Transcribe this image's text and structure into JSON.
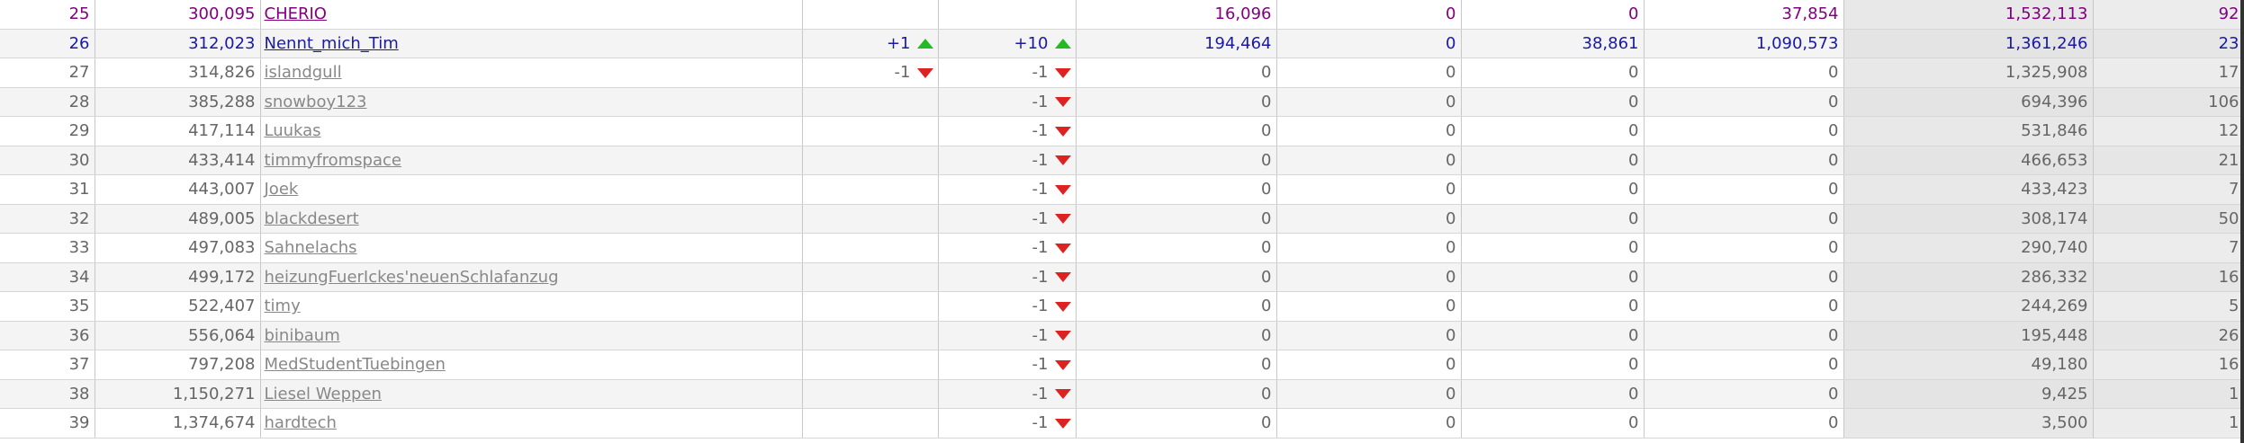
{
  "colors": {
    "highlight_text": "#800080",
    "self_text": "#1a1aa6",
    "muted_text": "#666666",
    "up_arrow": "#22bb22",
    "down_arrow": "#dd2222"
  },
  "rows": [
    {
      "pos": "25",
      "rank": "300,095",
      "name": "CHERIO",
      "change1": "",
      "dir1": "",
      "change2": "",
      "dir2": "",
      "v1": "16,096",
      "v2": "0",
      "v3": "0",
      "v4": "37,854",
      "total": "1,532,113",
      "last": "92",
      "style": "highlight"
    },
    {
      "pos": "26",
      "rank": "312,023",
      "name": "Nennt_mich_Tim",
      "change1": "+1",
      "dir1": "up",
      "change2": "+10",
      "dir2": "up",
      "v1": "194,464",
      "v2": "0",
      "v3": "38,861",
      "v4": "1,090,573",
      "total": "1,361,246",
      "last": "23",
      "style": "self"
    },
    {
      "pos": "27",
      "rank": "314,826",
      "name": "islandgull",
      "change1": "-1",
      "dir1": "down",
      "change2": "-1",
      "dir2": "down",
      "v1": "0",
      "v2": "0",
      "v3": "0",
      "v4": "0",
      "total": "1,325,908",
      "last": "17",
      "style": "normal"
    },
    {
      "pos": "28",
      "rank": "385,288",
      "name": "snowboy123",
      "change1": "",
      "dir1": "",
      "change2": "-1",
      "dir2": "down",
      "v1": "0",
      "v2": "0",
      "v3": "0",
      "v4": "0",
      "total": "694,396",
      "last": "106",
      "style": "normal"
    },
    {
      "pos": "29",
      "rank": "417,114",
      "name": "Luukas",
      "change1": "",
      "dir1": "",
      "change2": "-1",
      "dir2": "down",
      "v1": "0",
      "v2": "0",
      "v3": "0",
      "v4": "0",
      "total": "531,846",
      "last": "12",
      "style": "normal"
    },
    {
      "pos": "30",
      "rank": "433,414",
      "name": "timmyfromspace",
      "change1": "",
      "dir1": "",
      "change2": "-1",
      "dir2": "down",
      "v1": "0",
      "v2": "0",
      "v3": "0",
      "v4": "0",
      "total": "466,653",
      "last": "21",
      "style": "normal"
    },
    {
      "pos": "31",
      "rank": "443,007",
      "name": "Joek",
      "change1": "",
      "dir1": "",
      "change2": "-1",
      "dir2": "down",
      "v1": "0",
      "v2": "0",
      "v3": "0",
      "v4": "0",
      "total": "433,423",
      "last": "7",
      "style": "normal"
    },
    {
      "pos": "32",
      "rank": "489,005",
      "name": "blackdesert",
      "change1": "",
      "dir1": "",
      "change2": "-1",
      "dir2": "down",
      "v1": "0",
      "v2": "0",
      "v3": "0",
      "v4": "0",
      "total": "308,174",
      "last": "50",
      "style": "normal"
    },
    {
      "pos": "33",
      "rank": "497,083",
      "name": "Sahnelachs",
      "change1": "",
      "dir1": "",
      "change2": "-1",
      "dir2": "down",
      "v1": "0",
      "v2": "0",
      "v3": "0",
      "v4": "0",
      "total": "290,740",
      "last": "7",
      "style": "normal"
    },
    {
      "pos": "34",
      "rank": "499,172",
      "name": "heizungFuerIckes'neuenSchlafanzug",
      "change1": "",
      "dir1": "",
      "change2": "-1",
      "dir2": "down",
      "v1": "0",
      "v2": "0",
      "v3": "0",
      "v4": "0",
      "total": "286,332",
      "last": "16",
      "style": "normal"
    },
    {
      "pos": "35",
      "rank": "522,407",
      "name": "timy",
      "change1": "",
      "dir1": "",
      "change2": "-1",
      "dir2": "down",
      "v1": "0",
      "v2": "0",
      "v3": "0",
      "v4": "0",
      "total": "244,269",
      "last": "5",
      "style": "normal"
    },
    {
      "pos": "36",
      "rank": "556,064",
      "name": "binibaum",
      "change1": "",
      "dir1": "",
      "change2": "-1",
      "dir2": "down",
      "v1": "0",
      "v2": "0",
      "v3": "0",
      "v4": "0",
      "total": "195,448",
      "last": "26",
      "style": "normal"
    },
    {
      "pos": "37",
      "rank": "797,208",
      "name": "MedStudentTuebingen",
      "change1": "",
      "dir1": "",
      "change2": "-1",
      "dir2": "down",
      "v1": "0",
      "v2": "0",
      "v3": "0",
      "v4": "0",
      "total": "49,180",
      "last": "16",
      "style": "normal"
    },
    {
      "pos": "38",
      "rank": "1,150,271",
      "name": "Liesel Weppen",
      "change1": "",
      "dir1": "",
      "change2": "-1",
      "dir2": "down",
      "v1": "0",
      "v2": "0",
      "v3": "0",
      "v4": "0",
      "total": "9,425",
      "last": "1",
      "style": "normal"
    },
    {
      "pos": "39",
      "rank": "1,374,674",
      "name": "hardtech",
      "change1": "",
      "dir1": "",
      "change2": "-1",
      "dir2": "down",
      "v1": "0",
      "v2": "0",
      "v3": "0",
      "v4": "0",
      "total": "3,500",
      "last": "1",
      "style": "normal"
    }
  ]
}
